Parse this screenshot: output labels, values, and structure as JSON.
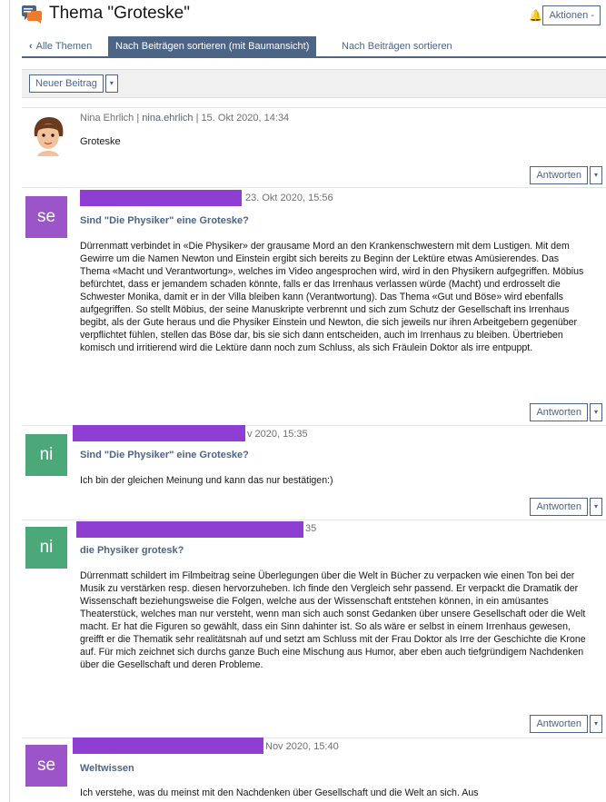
{
  "header": {
    "title": "Thema \"Groteske\"",
    "actions_label": "Aktionen -"
  },
  "tabs": [
    {
      "label": "Alle Themen"
    },
    {
      "label": "Nach Beiträgen sortieren (mit Baumansicht)"
    },
    {
      "label": "Nach Beiträgen sortieren"
    }
  ],
  "toolbar": {
    "new_post_label": "Neuer Beitrag",
    "caret": "▾"
  },
  "reply_label": "Antworten",
  "posts": [
    {
      "author": "Nina Ehrlich",
      "author_link": "nina.ehrlich",
      "date": "15. Okt 2020, 14:34",
      "subject": "",
      "body": "Groteske"
    },
    {
      "avatar": "se",
      "date": "23. Okt 2020, 15:56",
      "subject": "Sind \"Die Physiker\" eine Groteske?",
      "body": "Dürrenmatt verbindet in «Die Physiker» der grausame Mord an den Krankenschwestern mit dem Lustigen. Mit dem Gewirre um die Namen Newton und Einstein ergibt sich bereits zu Beginn der Lektüre etwas Amüsierendes. Das Thema «Macht und Verantwortung», welches im Video angesprochen wird, wird in den Physikern aufgegriffen. Möbius befürchtet, dass er jemandem schaden könnte, falls er das Irrenhaus verlassen würde (Macht) und erdrosselt die Schwester Monika, damit er in der Villa bleiben kann (Verantwortung). Das Thema «Gut und Böse» wird ebenfalls aufgegriffen. So stellt Möbius, der seine Manuskripte verbrennt und sich zum Schutz der Gesellschaft ins Irrenhaus begibt, als der Gute heraus und die Physiker Einstein und Newton, die sich jeweils nur ihren Arbeitgebern gegenüber verpflichtet fühlen, stellen das Böse dar, bis sie sich dann entscheiden, auch im Irrenhaus zu bleiben. Übertrieben komisch und irritierend wird die Lektüre dann noch zum Schluss, als sich Fräulein Doktor als irre entpuppt."
    },
    {
      "avatar": "ni",
      "date": "v 2020, 15:35",
      "subject": "Sind \"Die Physiker\" eine Groteske?",
      "body": "Ich bin der gleichen Meinung und kann das nur bestätigen:)"
    },
    {
      "avatar": "ni",
      "date": "35",
      "subject": "die Physiker grotesk?",
      "body": "Dürrenmatt schildert im Filmbeitrag seine Überlegungen über die Welt in Bücher zu verpacken wie einen Ton bei der Musik zu verstärken resp. diesen hervorzuheben. Ich finde den Vergleich sehr passend. Er verpackt die Dramatik der Wissenschaft beziehungsweise die Folgen, welche aus der Wissenschaft entstehen können, in ein amüsantes Theaterstück, welches man nur versteht, wenn man sich auch sonst Gedanken über unsere Gesellschaft oder die Welt macht. Er hat die Figuren so gewählt, dass ein Sinn dahinter ist. So als wäre er selbst in einem Irrenhaus gewesen, greifft er die Thematik sehr realitätsnah auf und setzt am Schluss mit der Frau Doktor als Irre der Geschichte die Krone auf. Für mich zeichnet sich durchs ganze Buch eine Mischung aus Humor, aber eben auch tiefgründigem Nachdenken über die Gesellschaft und deren Probleme."
    },
    {
      "avatar": "se",
      "date": "Nov 2020, 15:40",
      "subject": "Weltwissen",
      "body": "Ich verstehe, was du meinst mit den Nachdenken über Gesellschaft und die Welt an sich. Aus"
    }
  ],
  "colors": {
    "accent": "#4c6586",
    "avatar_se": "#9b55c9",
    "avatar_ni": "#4aa879",
    "redaction": "#8e3ed0"
  }
}
